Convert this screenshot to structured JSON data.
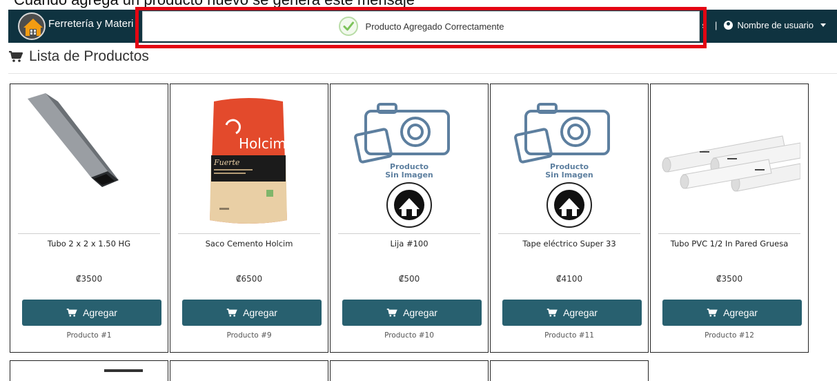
{
  "colors": {
    "navbar": "#0f3340",
    "button": "#28606f",
    "highlight": "#e30613",
    "success": "#7dc35b"
  },
  "top_caption": "Cuando agrega un producto nuevo se genera este mensaje",
  "header": {
    "brand": "Ferretería y Materi",
    "right_partial": "s",
    "separator": "|",
    "user_label": "Nombre de usuario"
  },
  "toast": {
    "message": "Producto Agregado Correctamente",
    "icon": "check-circle-icon"
  },
  "page": {
    "title": "Lista de Productos",
    "title_icon": "cart-icon"
  },
  "placeholder_image": {
    "line1": "Producto",
    "line2": "Sin Imagen"
  },
  "products": [
    {
      "name": "Tubo 2 x 2 x 1.50 HG",
      "price": "₡3500",
      "button": "Agregar",
      "id": "Producto #1",
      "image": "square-tube"
    },
    {
      "name": "Saco Cemento Holcim",
      "price": "₡6500",
      "button": "Agregar",
      "id": "Producto #9",
      "image": "cement-bag"
    },
    {
      "name": "Lija #100",
      "price": "₡500",
      "button": "Agregar",
      "id": "Producto #10",
      "image": "no-image"
    },
    {
      "name": "Tape eléctrico Super 33",
      "price": "₡4100",
      "button": "Agregar",
      "id": "Producto #11",
      "image": "no-image"
    },
    {
      "name": "Tubo PVC 1/2 In Pared Gruesa",
      "price": "₡3500",
      "button": "Agregar",
      "id": "Producto #12",
      "image": "pvc-pipes"
    }
  ],
  "cement_bag": {
    "brand": "Holcim",
    "variant": "Fuerte"
  }
}
